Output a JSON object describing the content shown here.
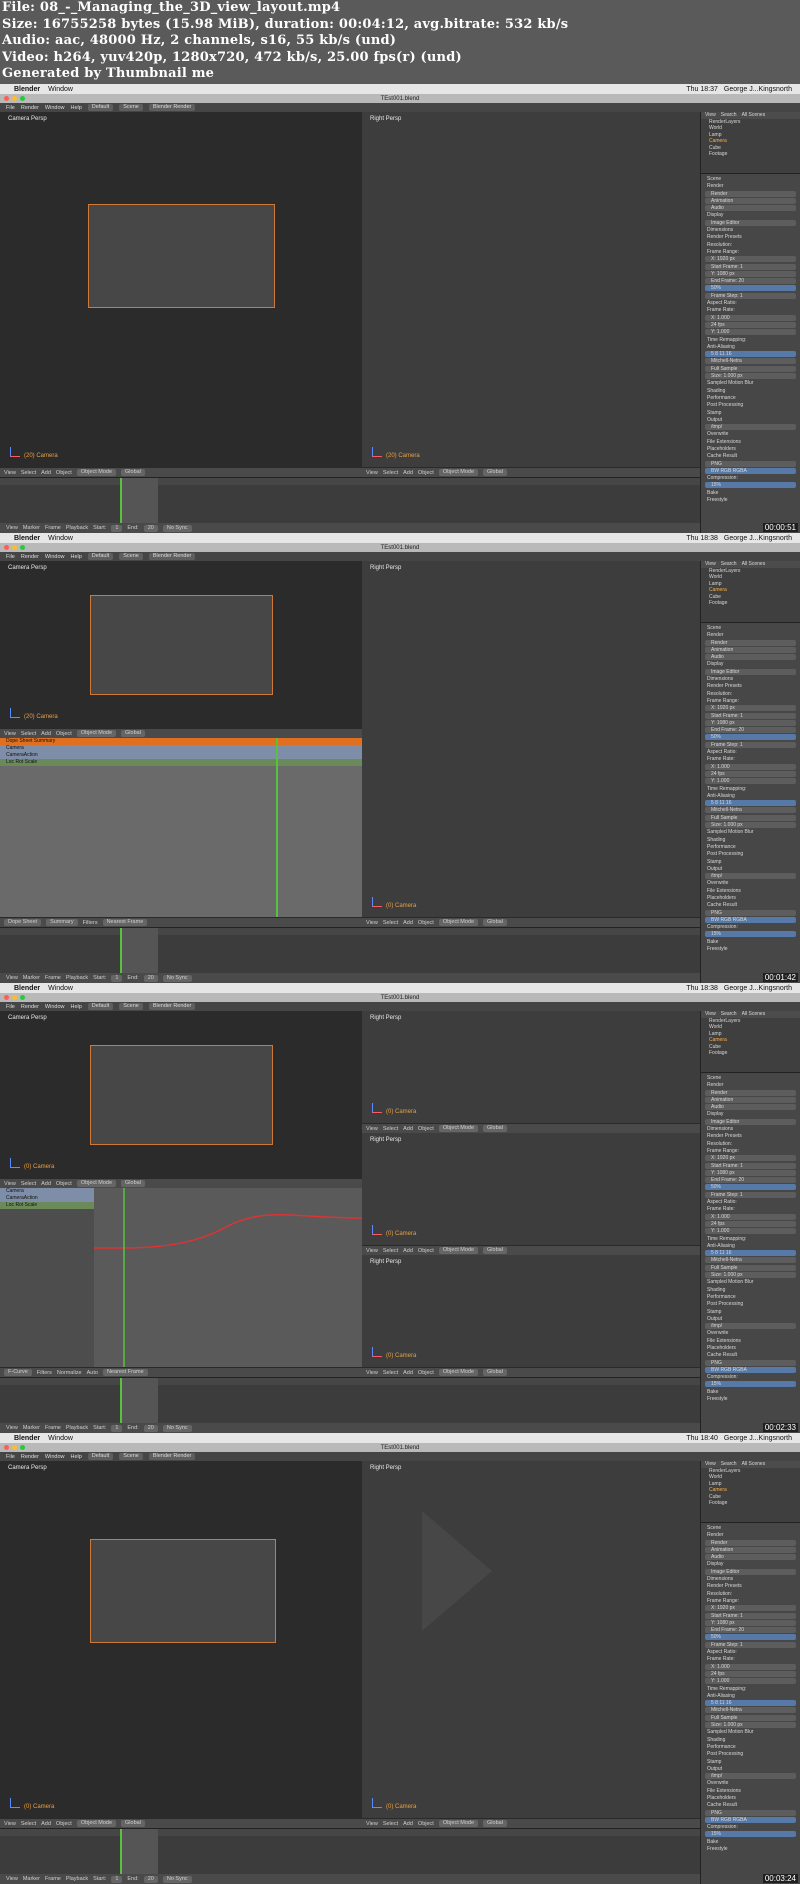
{
  "header": {
    "file": "File: 08_-_Managing_the_3D_view_layout.mp4",
    "size": "Size: 16755258 bytes (15.98 MiB), duration: 00:04:12, avg.bitrate: 532 kb/s",
    "audio": "Audio: aac, 48000 Hz, 2 channels, s16, 55 kb/s (und)",
    "video": "Video: h264, yuv420p, 1280x720, 472 kb/s, 25.00 fps(r) (und)",
    "generated": "Generated by Thumbnail me"
  },
  "menubar": {
    "apple": "",
    "app": "Blender",
    "window": "Window",
    "user": "George J...Kingsnorth"
  },
  "window_title": "TEst001.blend",
  "info": {
    "file": "File",
    "render": "Render",
    "window": "Window",
    "help": "Help",
    "layout": "Default",
    "scene": "Scene",
    "engine": "Blender Render"
  },
  "viewports": {
    "camera_persp": "Camera Persp",
    "right_persp": "Right Persp",
    "camera_label": "(0) Camera",
    "camera_label_20": "(20) Camera"
  },
  "toolbar": {
    "view": "View",
    "select": "Select",
    "add": "Add",
    "object": "Object",
    "object_mode": "Object Mode",
    "global": "Global"
  },
  "timeline": {
    "view": "View",
    "marker": "Marker",
    "frame": "Frame",
    "playback": "Playback",
    "start": "Start:",
    "end": "End:",
    "start_val": "1",
    "end_val": "20",
    "nosync": "No Sync"
  },
  "props": {
    "outliner": [
      "View",
      "Search",
      "All Scenes"
    ],
    "scene_items": [
      "RenderLayers",
      "World",
      "Lamp",
      "Camera",
      "Cube",
      "Footage"
    ],
    "rows": [
      "Scene",
      "Render",
      "Render",
      "Animation",
      "Audio",
      "Display",
      "Image Editor",
      "Dimensions",
      "Render Presets",
      "Resolution:",
      "Frame Range:",
      "X: 1920 px",
      "Start Frame: 1",
      "Y: 1080 px",
      "End Frame: 20",
      "50%",
      "Frame Step: 1",
      "Aspect Ratio:",
      "Frame Rate:",
      "X: 1.000",
      "24 fps",
      "Y: 1.000",
      "Time Remapping:",
      "Anti-Aliasing",
      "5  8  11  16",
      "Mitchell-Netra",
      "Full Sample",
      "Size: 1.000 px",
      "Sampled Motion Blur",
      "Shading",
      "Performance",
      "Post Processing",
      "Stamp",
      "Output",
      "/tmp/",
      "Overwrite",
      "File Extensions",
      "Placeholders",
      "Cache Result",
      "PNG",
      "BW  RGB  RGBA",
      "Compression:",
      "15%",
      "Bake",
      "Freestyle"
    ]
  },
  "dopesheet": {
    "summary": "Dope Sheet Summary",
    "camera": "Camera",
    "cam_action": "CameraAction",
    "loc": "Loc Rot Scale",
    "mode": "Dope Sheet",
    "summary_btn": "Summary",
    "filters": "Filters",
    "nearest": "Nearest Frame"
  },
  "graph": {
    "fcurve": "F-Curve",
    "filters": "Filters",
    "normalize": "Normalize",
    "auto": "Auto",
    "nearest": "Nearest Frame",
    "pivot": "Camera",
    "channel": "CameraAction",
    "channel2": "Loc Rot Scale"
  },
  "timestamps": [
    "00:00:51",
    "00:01:42",
    "00:02:33",
    "00:03:24"
  ],
  "clock": [
    "Thu 18:37",
    "Thu 18:38",
    "Thu 18:38",
    "Thu 18:40"
  ],
  "colors": {
    "accent": "#d0783a",
    "frame": "#58c23d",
    "selected": "#ffb142"
  }
}
